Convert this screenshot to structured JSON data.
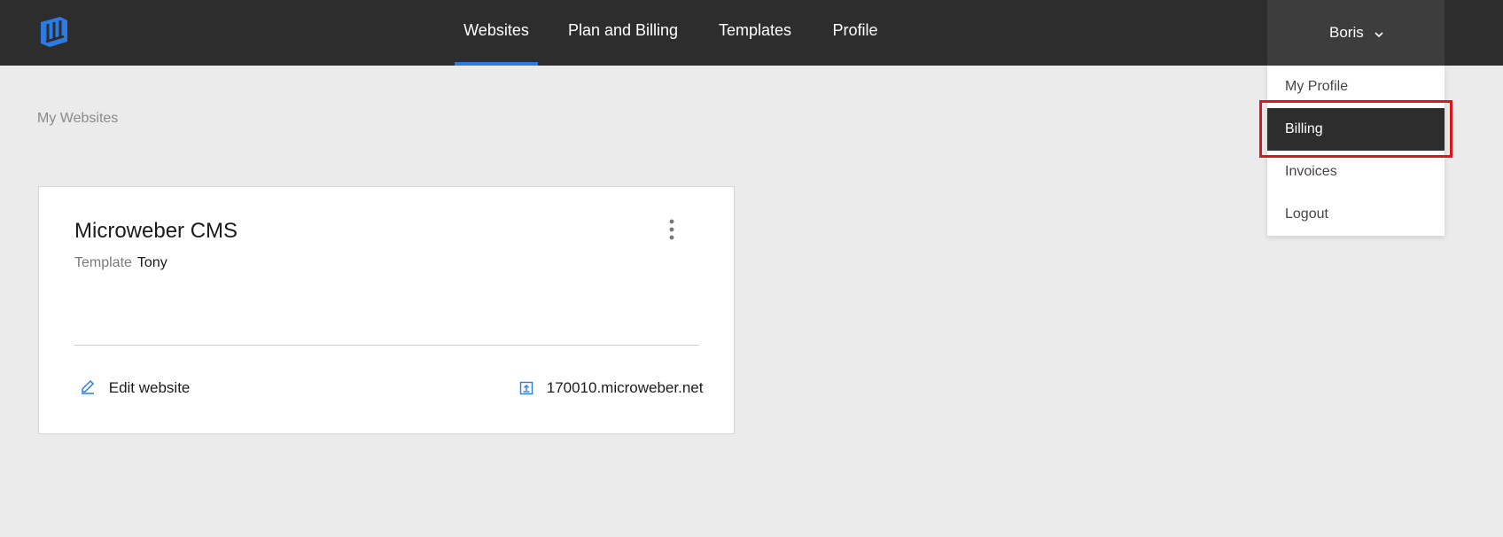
{
  "header": {
    "nav": [
      {
        "label": "Websites",
        "active": true
      },
      {
        "label": "Plan and Billing",
        "active": false
      },
      {
        "label": "Templates",
        "active": false
      },
      {
        "label": "Profile",
        "active": false
      }
    ],
    "user": {
      "name": "Boris"
    }
  },
  "user_menu": {
    "items": [
      {
        "label": "My Profile",
        "highlighted": false
      },
      {
        "label": "Billing",
        "highlighted": true
      },
      {
        "label": "Invoices",
        "highlighted": false
      },
      {
        "label": "Logout",
        "highlighted": false
      }
    ]
  },
  "breadcrumb": "My Websites",
  "website_card": {
    "title": "Microweber CMS",
    "template_label": "Template",
    "template_name": "Tony",
    "edit_label": "Edit website",
    "domain": "170010.microweber.net"
  },
  "colors": {
    "topbar": "#2d2d2d",
    "accent": "#2c7be5",
    "highlight": "#e0141b",
    "background": "#ebebeb"
  },
  "icons": [
    "microweber-logo",
    "chevron-down-icon",
    "kebab-menu-icon",
    "pencil-icon",
    "external-link-icon"
  ]
}
